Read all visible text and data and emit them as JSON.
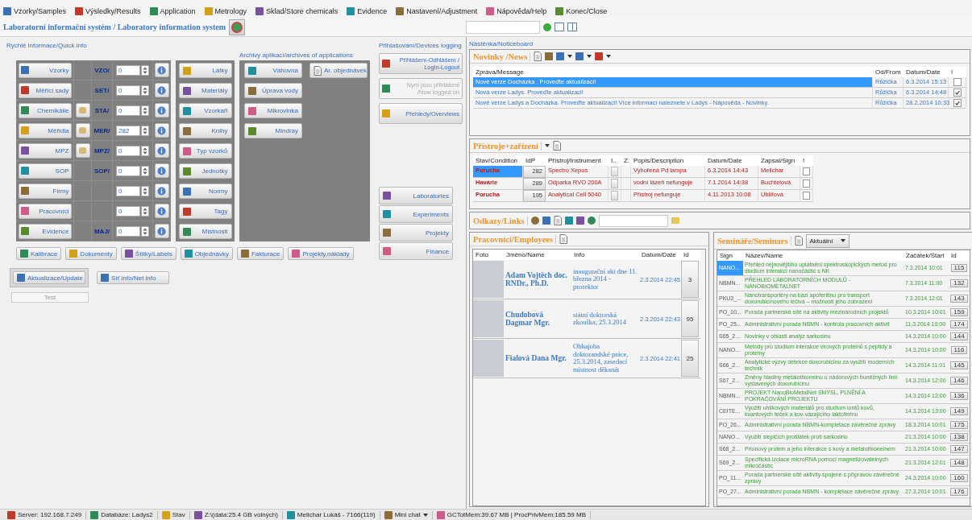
{
  "menu": [
    {
      "label": "Vzorky/Samples"
    },
    {
      "label": "Výsledky/Results"
    },
    {
      "label": "Application"
    },
    {
      "label": "Metrology"
    },
    {
      "label": "Sklad/Store chemicals"
    },
    {
      "label": "Evidence"
    },
    {
      "label": "Nastavení/Adjustment"
    },
    {
      "label": "Nápověda/Help"
    },
    {
      "label": "Konec/Close"
    }
  ],
  "title_bar": {
    "title": "Laboratorní informační systém / Laboratory information system"
  },
  "quick_info": {
    "label": "Rychlé informace/Quick info",
    "rows": [
      {
        "button": "Vzorky",
        "extra": false,
        "code": "VZO/",
        "value": "0"
      },
      {
        "button": "Měřicí sady",
        "extra": false,
        "code": "SET/",
        "value": "0"
      },
      {
        "button": "Chemikálie",
        "extra": true,
        "code": "STA/",
        "value": "0"
      },
      {
        "button": "Měřidla",
        "extra": true,
        "code": "MER/",
        "value": "282"
      },
      {
        "button": "MPZ",
        "extra": true,
        "code": "MPZ/",
        "value": "0"
      },
      {
        "button": "SOP",
        "extra": false,
        "code": "SOP/",
        "value": "0"
      },
      {
        "button": "Firmy",
        "extra": false,
        "value": "0"
      },
      {
        "button": "Pracovníci",
        "extra": false,
        "value": "0"
      },
      {
        "button": "Evidence",
        "extra": false,
        "code": "MAJ/",
        "value": "0"
      }
    ],
    "items": [
      "Látky",
      "Materiály",
      "Vzorkaři",
      "Knihy",
      "Typ vzorků",
      "Jednotky",
      "Normy",
      "Tagy",
      "Místnosti"
    ],
    "archive": {
      "label": "Archivy aplikací/archives of applications",
      "items": [
        "Váhovna",
        "Úprava vody",
        "Mikrovlnka",
        "Mindray"
      ],
      "orders_button": "Ar. objednávek"
    },
    "bottom_buttons": [
      "Kalibrace",
      "Dokumenty",
      "Štítky/Labels",
      "Objednávky",
      "Fakturace",
      "Projekty,náklady"
    ]
  },
  "devices": {
    "label": "Přihlašování/Devices logging",
    "buttons": [
      {
        "label": "Přihlášení-Odhlášení / Login-Logout",
        "disabled": false
      },
      {
        "label": "Nyní jsou přihlášeni /Now logged on",
        "disabled": true
      },
      {
        "label": "Přehledy/Overviews",
        "disabled": false
      }
    ],
    "lower_buttons": [
      "Laboratories",
      "Experiments",
      "Projekty",
      "Finance"
    ]
  },
  "update_buttons": [
    "Aktualizace/Update",
    "Síť info/Net info"
  ],
  "test_button": {
    "label": "Test",
    "disabled": true
  },
  "noticeboard": {
    "label": "Nástěnka/Noticeboard"
  },
  "news": {
    "title": "Novinky /News",
    "columns": [
      "Zpráva/Message",
      "Od/From",
      "Datum/Date",
      "!"
    ],
    "rows": [
      {
        "message": "Nové verze Docházka . Proveďte aktualizaci!",
        "from": "Růžička",
        "date": "6.3.2014 15:13",
        "flag": false,
        "selected": true
      },
      {
        "message": "Nová verze Ladys. Proveďte aktualizaci!",
        "from": "Růžička",
        "date": "6.3.2014 14:48",
        "flag": true,
        "selected": false
      },
      {
        "message": "Nové verze Ladys a Docházka. Proveďte aktualizaci! Více informací naleznete v Ladys - Nápověda - Novinky.",
        "from": "Růžička",
        "date": "28.2.2014 10:33",
        "flag": true,
        "selected": false
      }
    ]
  },
  "instruments": {
    "title": "Přístroje+zařízení",
    "columns": [
      "Stav/Condition",
      "IdP",
      "Přístroj/Instrument",
      "I..",
      "Z.",
      "Popis/Description",
      "Datum/Date",
      "Zapsal/Sign",
      "!"
    ],
    "rows": [
      {
        "condition": "Porucha",
        "idp": "282",
        "instrument": "Spectro Xepos",
        "description": "Vyhořená Pd lampa",
        "date": "6.3.2014 14:43",
        "sign": "Melichar",
        "flag": false,
        "selected": true
      },
      {
        "condition": "Havárie",
        "idp": "289",
        "instrument": "Odparka RVO 200A",
        "description": "vodní lázeň nefunguje",
        "date": "7.1.2014 14:38",
        "sign": "Buchtelová",
        "flag": false,
        "selected": false
      },
      {
        "condition": "Porucha",
        "idp": "195",
        "instrument": "Analytical Cell 5040",
        "description": "Přístroj nefunguje",
        "date": "4.11.2013 10:08",
        "sign": "Uhlířová",
        "flag": false,
        "selected": false
      }
    ]
  },
  "links": {
    "title": "Odkazy/Links"
  },
  "employees": {
    "title": "Pracovníci/Employees",
    "columns": [
      "Foto",
      "Jméno/Name",
      "Info",
      "Datum/Date",
      "Id"
    ],
    "rows": [
      {
        "name": "Adam Vojtěch doc. RNDr., Ph.D.",
        "info": "inaugurační akt dne 11. března 2014 - prorektor",
        "date": "2.3.2014 22:45",
        "id": "3"
      },
      {
        "name": "Chudobová Dagmar Mgr.",
        "info": "státní doktorská zkouška, 25.3.2014",
        "date": "2.3.2014 22:43",
        "id": "95"
      },
      {
        "name": "Fialová Dana Mgr.",
        "info": "Obhajoba doktorandské práce, 25.3.2014, zasedací místnost děkanát",
        "date": "2.3.2014 22:41",
        "id": "25"
      }
    ]
  },
  "seminars": {
    "title": "Semináře/Seminars",
    "filter": "Aktuální",
    "columns": [
      "Sign",
      "Název/Name",
      "Začátek/Start",
      "Id"
    ],
    "rows": [
      {
        "sign": "NANO...",
        "name": "Přehled nejnovějšího uplatnění spektroskopických metod pro studium interakcí nanočástic s NK",
        "start": "7.3.2014 10:01",
        "id": "115",
        "selected": true
      },
      {
        "sign": "NBMN...",
        "name": "PŘEHLED LABORATORNÍCH MODULŮ - NANOBIOMETALNET",
        "start": "7.3.2014 11:00",
        "id": "132",
        "selected": false
      },
      {
        "sign": "PKU2_...",
        "name": "Nanotransportéry na bázi apoferitinu pro transport doxorubicinového léčiva – možnosti jeho zobrazení",
        "start": "7.3.2014 12:01",
        "id": "143",
        "selected": false
      },
      {
        "sign": "PO_10...",
        "name": "Porada partnerské sítě na aktivity mezinárodních projektů",
        "start": "10.3.2014 10:01",
        "id": "159",
        "selected": false
      },
      {
        "sign": "PO_25...",
        "name": "Administrativní porada NBMN - kontrola pracovních aktivit",
        "start": "11.3.2014 10:00",
        "id": "174",
        "selected": false
      },
      {
        "sign": "S65_2...",
        "name": "Novinky v oblasti analýz sarkosinu",
        "start": "14.3.2014 10:00",
        "id": "144",
        "selected": false
      },
      {
        "sign": "NANO...",
        "name": "Metody pro studium interakce virových proteinů s peptidy a proteiny",
        "start": "14.3.2014 10:00",
        "id": "116",
        "selected": false
      },
      {
        "sign": "S66_2...",
        "name": "Analytické výzvy detekce doxorubicinu za využití moderních technik",
        "start": "14.3.2014 11:01",
        "id": "145",
        "selected": false
      },
      {
        "sign": "S67_2...",
        "name": "Změny hladiny metalothioneinu u nádorových buněčných linií vystavených doxorubicinu",
        "start": "14.3.2014 12:00",
        "id": "146",
        "selected": false
      },
      {
        "sign": "NBMN...",
        "name": "PROJEKT NanoBioMetalNet SMYSL, PLNĚNÍ A POKRAČOVÁNÍ PROJEKTU",
        "start": "14.3.2014 12:00",
        "id": "136",
        "selected": false
      },
      {
        "sign": "CEITE...",
        "name": "Využití uhlíkových materiálů pro studium iontů kovů, kvantových teček a kov-vázajícího laktoferinu",
        "start": "14.3.2014 13:00",
        "id": "149",
        "selected": false
      },
      {
        "sign": "PO_26...",
        "name": "Administrativní porada NBMN-kompletace závěrečné zprávy",
        "start": "18.3.2014 10:01",
        "id": "175",
        "selected": false
      },
      {
        "sign": "NANO...",
        "name": "Využití slepičích protilátek proti sarkosinu",
        "start": "21.3.2014 10:00",
        "id": "138",
        "selected": false
      },
      {
        "sign": "S68_2...",
        "name": "Prionový protein a jeho interakce s kovy a metalothioneinem",
        "start": "21.3.2014 10:00",
        "id": "147",
        "selected": false
      },
      {
        "sign": "S69_2...",
        "name": "Specifická izolace microRNA pomocí magnetizovatelných mikročástic",
        "start": "21.3.2014 12:01",
        "id": "148",
        "selected": false
      },
      {
        "sign": "PO_11...",
        "name": "Porada partnerské sítě aktivity spojené s přípravou závěrečné zprávy",
        "start": "24.3.2014 10:00",
        "id": "160",
        "selected": false
      },
      {
        "sign": "PO_27...",
        "name": "Administrativní porada NBMN - kompletace závěrečné zprávy",
        "start": "27.3.2014 10:01",
        "id": "176",
        "selected": false
      }
    ]
  },
  "status_bar": {
    "items": [
      {
        "kind": "label",
        "text": "Server:  192.168.7.249"
      },
      {
        "kind": "label",
        "text": "Databáze:  Ladys2"
      },
      {
        "kind": "label",
        "text": "Stav"
      },
      {
        "kind": "label",
        "text": "Z:\\(data:25.4 GB volných)"
      },
      {
        "kind": "label",
        "text": "Melichar Lukáš - 7166(119)"
      },
      {
        "kind": "dropdown",
        "text": "Mini chat"
      },
      {
        "kind": "label",
        "text": "GCTotMem:39.67 MB | ProcPrivMem:185.59 MB"
      }
    ]
  }
}
